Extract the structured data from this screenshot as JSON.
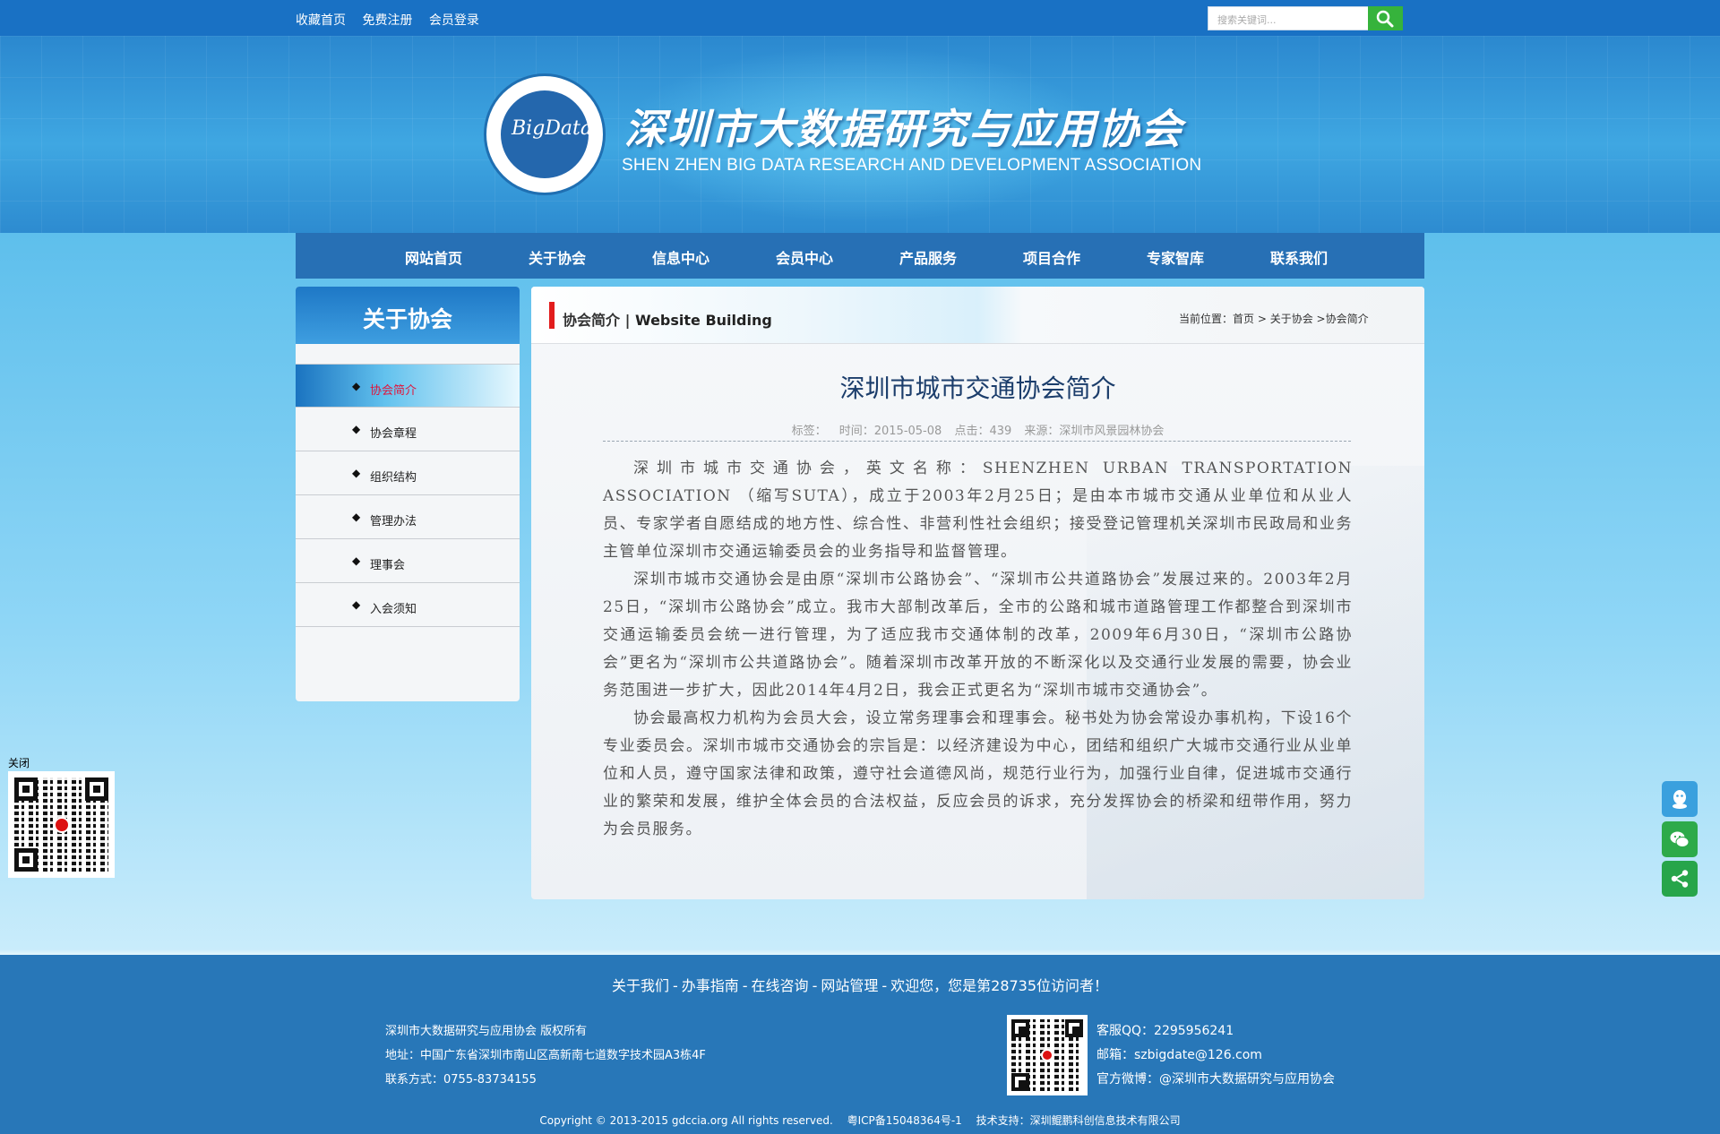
{
  "top": {
    "links": [
      "收藏首页",
      "免费注册",
      "会员登录"
    ],
    "search_placeholder": "搜索关键词..."
  },
  "banner": {
    "title": "深圳市大数据研究与应用协会",
    "subtitle": "SHEN ZHEN BIG DATA RESEARCH AND DEVELOPMENT ASSOCIATION",
    "logo_text": "BigData"
  },
  "nav": [
    "网站首页",
    "关于协会",
    "信息中心",
    "会员中心",
    "产品服务",
    "项目合作",
    "专家智库",
    "联系我们"
  ],
  "sidebar": {
    "title": "关于协会",
    "items": [
      "协会简介",
      "协会章程",
      "组织结构",
      "管理办法",
      "理事会",
      "入会须知"
    ],
    "active_index": 0
  },
  "main": {
    "section_title": "协会简介 |",
    "section_en": "Website Building",
    "breadcrumb_prefix": "当前位置：",
    "breadcrumb": [
      "首页",
      "关于协会",
      "协会简介"
    ],
    "article_title": "深圳市城市交通协会简介",
    "meta": [
      "标签：",
      "时间：2015-05-08",
      "点击：439",
      "来源：深圳市风景园林协会"
    ],
    "paragraphs": [
      "深圳市城市交通协会，英文名称：SHENZHEN URBAN TRANSPORTATION ASSOCIATION （缩写SUTA），成立于2003年2月25日；是由本市城市交通从业单位和从业人员、专家学者自愿结成的地方性、综合性、非营利性社会组织；接受登记管理机关深圳市民政局和业务主管单位深圳市交通运输委员会的业务指导和监督管理。",
      "深圳市城市交通协会是由原“深圳市公路协会”、“深圳市公共道路协会”发展过来的。2003年2月25日，“深圳市公路协会”成立。我市大部制改革后，全市的公路和城市道路管理工作都整合到深圳市交通运输委员会统一进行管理，为了适应我市交通体制的改革，2009年6月30日，“深圳市公路协会”更名为“深圳市公共道路协会”。随着深圳市改革开放的不断深化以及交通行业发展的需要，协会业务范围进一步扩大，因此2014年4月2日，我会正式更名为“深圳市城市交通协会”。",
      "协会最高权力机构为会员大会，设立常务理事会和理事会。秘书处为协会常设办事机构，下设16个专业委员会。深圳市城市交通协会的宗旨是：以经济建设为中心，团结和组织广大城市交通行业从业单位和人员，遵守国家法律和政策，遵守社会道德风尚，规范行业行为，加强行业自律，促进城市交通行业的繁荣和发展，维护全体会员的合法权益，反应会员的诉求，充分发挥协会的桥梁和纽带作用，努力为会员服务。"
    ]
  },
  "floating": {
    "close_label": "关闭"
  },
  "footer": {
    "links": [
      "关于我们",
      "办事指南",
      "在线咨询",
      "网站管理"
    ],
    "visitor": "欢迎您，您是第28735位访问者！",
    "info": [
      "深圳市大数据研究与应用协会 版权所有",
      "地址：中国广东省深圳市南山区高新南七道数字技术园A3栋4F",
      "联系方式：0755-83734155"
    ],
    "contact": [
      "客服QQ：2295956241",
      "邮箱：szbigdate@126.com",
      "官方微博：@深圳市大数据研究与应用协会"
    ],
    "copyright": "Copyright © 2013-2015 gdccia.org All rights reserved.",
    "icp": "粤ICP备15048364号-1",
    "tech": "技术支持：深圳鲲鹏科创信息技术有限公司"
  },
  "colors": {
    "topbar": "#1971c4",
    "nav": "#2770b5",
    "footer": "#2877b8",
    "accent_red": "#e21c1c",
    "search_button": "#36b33c"
  },
  "icons": [
    "search-icon",
    "qq-icon",
    "wechat-icon",
    "share-icon",
    "diamond-bullet-icon"
  ]
}
